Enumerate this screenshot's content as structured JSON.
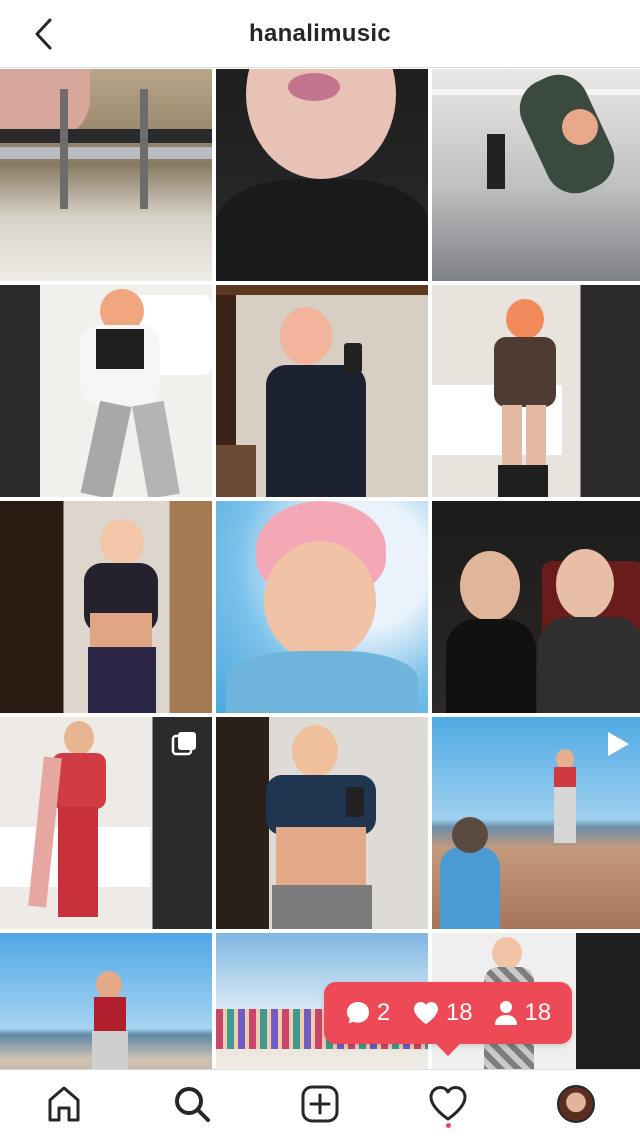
{
  "header": {
    "username": "hanalimusic",
    "back_icon": "chevron-left-icon"
  },
  "grid": {
    "posts": [
      {
        "id": "post-1",
        "desc": "gym equipment",
        "type": "photo"
      },
      {
        "id": "post-2",
        "desc": "selfie close-up",
        "type": "photo"
      },
      {
        "id": "post-3",
        "desc": "handstand in gym",
        "type": "photo"
      },
      {
        "id": "post-4",
        "desc": "bedroom workout",
        "type": "photo"
      },
      {
        "id": "post-5",
        "desc": "mirror selfie",
        "type": "photo"
      },
      {
        "id": "post-6",
        "desc": "mirror selfie bedroom",
        "type": "photo"
      },
      {
        "id": "post-7",
        "desc": "mirror selfie abs",
        "type": "photo"
      },
      {
        "id": "post-8",
        "desc": "outdoor selfie",
        "type": "photo"
      },
      {
        "id": "post-9",
        "desc": "couple selfie",
        "type": "photo"
      },
      {
        "id": "post-10",
        "desc": "red outfit",
        "type": "carousel"
      },
      {
        "id": "post-11",
        "desc": "mirror selfie abs",
        "type": "photo"
      },
      {
        "id": "post-12",
        "desc": "beach photoshoot",
        "type": "video"
      },
      {
        "id": "post-13",
        "desc": "beach pose",
        "type": "photo"
      },
      {
        "id": "post-14",
        "desc": "group beach",
        "type": "photo"
      },
      {
        "id": "post-15",
        "desc": "snake print outfit",
        "type": "photo"
      }
    ]
  },
  "activity": {
    "comments": "2",
    "likes": "18",
    "followers": "18",
    "color": "#ed4956"
  },
  "nav": {
    "items": [
      "home-icon",
      "search-icon",
      "new-post-icon",
      "activity-heart-icon",
      "profile-avatar"
    ]
  }
}
